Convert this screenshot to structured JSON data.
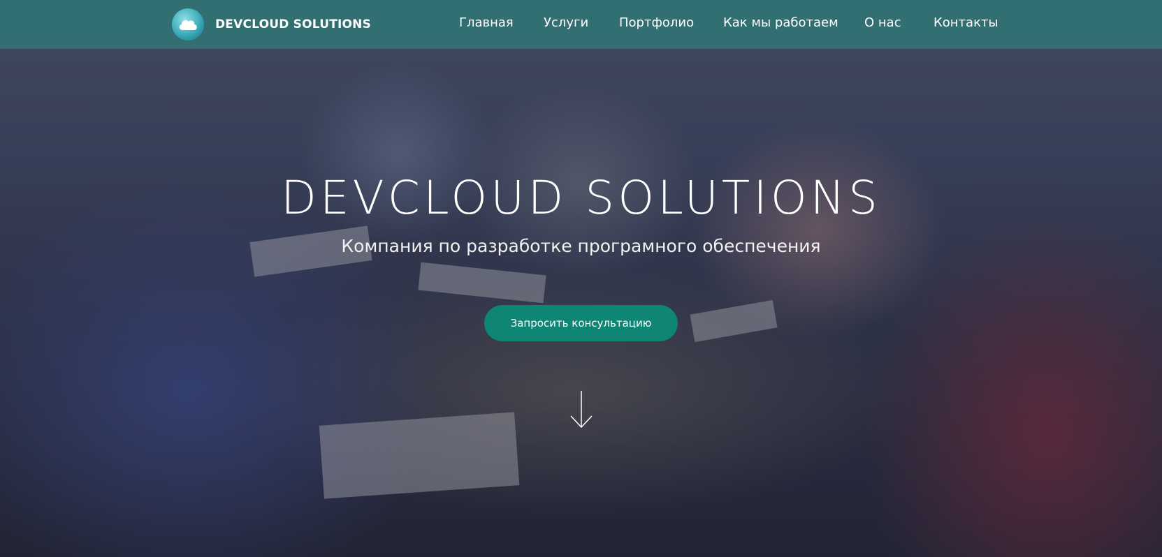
{
  "brand": {
    "name": "DEVCLOUD SOLUTIONS",
    "logo_icon": "cloud-icon"
  },
  "nav": {
    "items": [
      {
        "label": "Главная"
      },
      {
        "label": "Услуги"
      },
      {
        "label": "Портфолио"
      },
      {
        "label": "Как мы работаем"
      },
      {
        "label": "О нас"
      },
      {
        "label": "Контакты"
      }
    ]
  },
  "hero": {
    "title": "DEVCLOUD SOLUTIONS",
    "subtitle": "Компания по разработке програмного обеспечения",
    "cta_label": "Запросить консультацию",
    "scroll_icon": "arrow-down-icon",
    "background": "photo of team meeting around a table"
  },
  "colors": {
    "navbar": "#2f7876",
    "cta": "#0f8573",
    "text": "#ffffff"
  }
}
